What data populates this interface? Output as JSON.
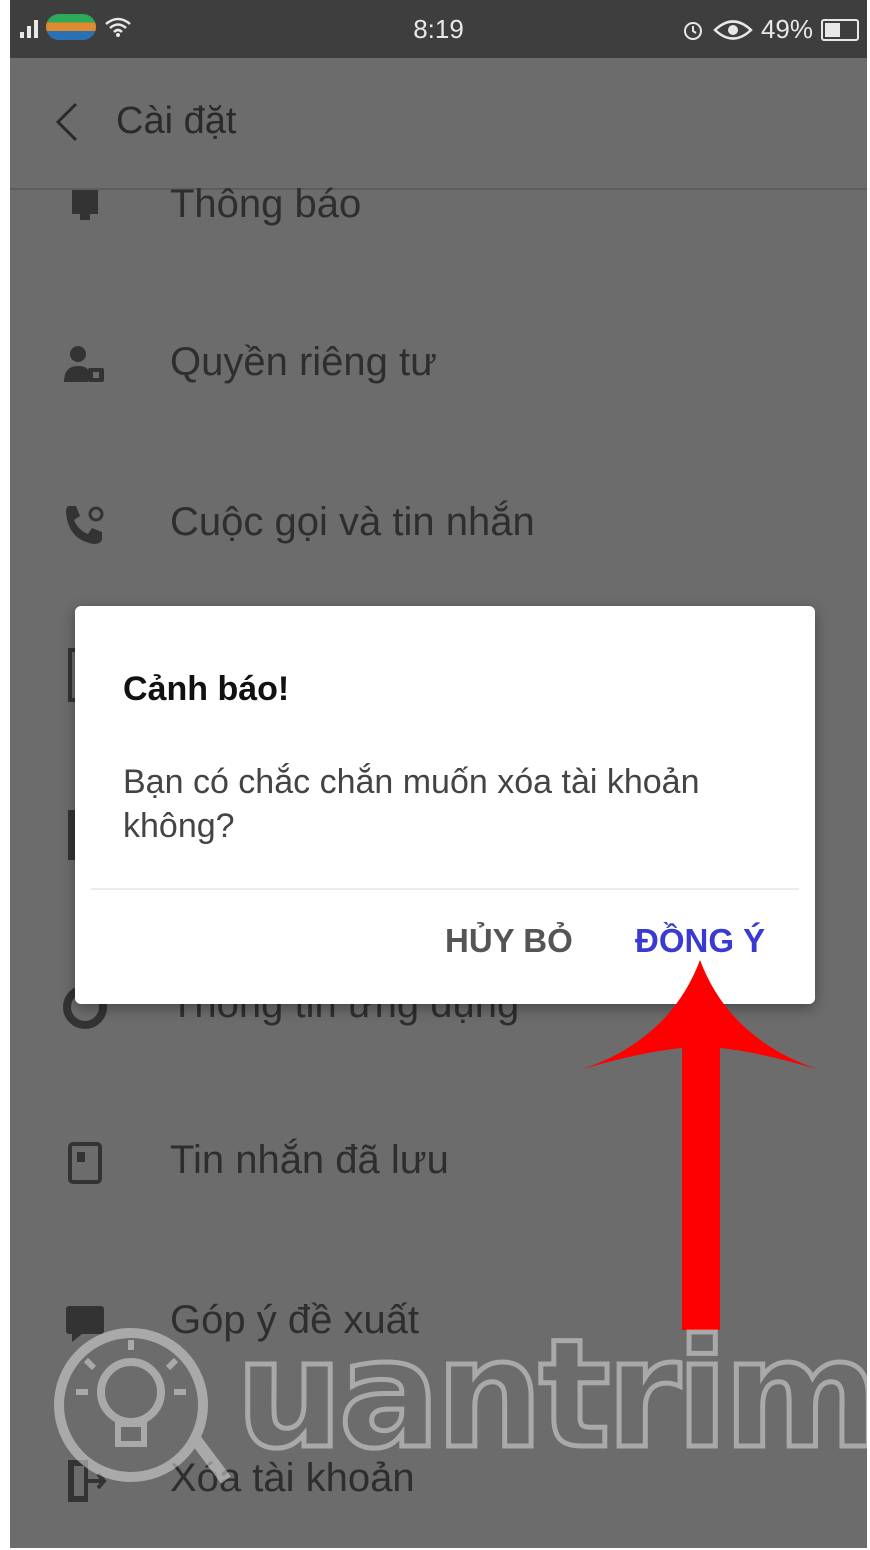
{
  "status_bar": {
    "time": "8:19",
    "battery": "49%"
  },
  "header": {
    "title": "Cài đặt"
  },
  "settings": {
    "items": [
      {
        "label": "Thông báo",
        "icon": "bell-icon"
      },
      {
        "label": "Quyền riêng tư",
        "icon": "user-lock-icon"
      },
      {
        "label": "Cuộc gọi và tin nhắn",
        "icon": "phone-icon"
      },
      {
        "label": "Thông tin ứng dụng",
        "icon": "info-icon"
      },
      {
        "label": "Tin nhắn đã lưu",
        "icon": "saved-message-icon"
      },
      {
        "label": "Góp ý đề xuất",
        "icon": "feedback-icon"
      },
      {
        "label": "Xóa tài khoản",
        "icon": "exit-icon"
      }
    ]
  },
  "dialog": {
    "title": "Cảnh báo!",
    "message": "Bạn có chắc chắn muốn xóa tài khoản không?",
    "cancel_label": "HỦY BỎ",
    "confirm_label": "ĐỒNG Ý"
  },
  "watermark": {
    "text": "uantrimang"
  },
  "colors": {
    "overlay": "#6c6c6c",
    "accent": "#3a3ad2",
    "arrow": "#ff0000"
  }
}
